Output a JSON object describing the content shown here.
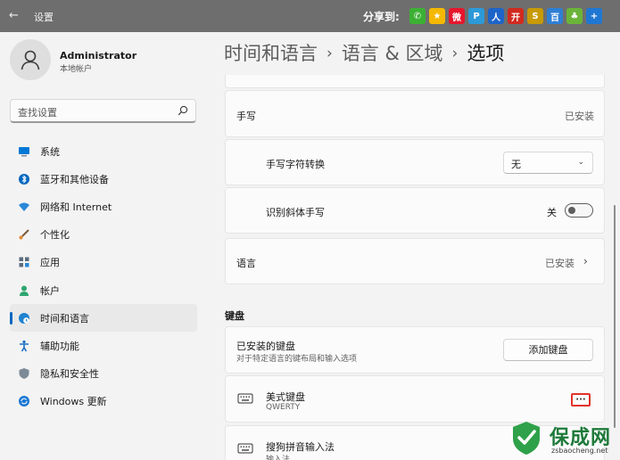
{
  "window": {
    "title": "设置",
    "back_glyph": "←"
  },
  "share": {
    "label": "分享到:",
    "icons": [
      {
        "name": "wechat-icon",
        "color": "#3cb034",
        "glyph": "✆"
      },
      {
        "name": "qzone-icon",
        "color": "#f5b800",
        "glyph": "★"
      },
      {
        "name": "weibo-icon",
        "color": "#e6162d",
        "glyph": "微"
      },
      {
        "name": "tencent-weibo-icon",
        "color": "#2c9ad8",
        "glyph": "P"
      },
      {
        "name": "renren-icon",
        "color": "#1e64c8",
        "glyph": "人"
      },
      {
        "name": "kaixin-icon",
        "color": "#d12a1f",
        "glyph": "开"
      },
      {
        "name": "douban-icon",
        "color": "#c79a06",
        "glyph": "S"
      },
      {
        "name": "baidu-icon",
        "color": "#2e7fd4",
        "glyph": "百"
      },
      {
        "name": "clover-icon",
        "color": "#6bb43a",
        "glyph": "♣"
      },
      {
        "name": "more-share-icon",
        "color": "#1f77d2",
        "glyph": "+"
      }
    ]
  },
  "user": {
    "name": "Administrator",
    "type": "本地帐户"
  },
  "search": {
    "placeholder": "查找设置"
  },
  "sidebar": {
    "items": [
      {
        "label": "系统",
        "icon": "monitor-icon",
        "color": "#0078d4"
      },
      {
        "label": "蓝牙和其他设备",
        "icon": "bluetooth-icon",
        "color": "#0067c0"
      },
      {
        "label": "网络和 Internet",
        "icon": "wifi-icon",
        "color": "#2a88d8"
      },
      {
        "label": "个性化",
        "icon": "brush-icon",
        "color": "#e18a2f"
      },
      {
        "label": "应用",
        "icon": "apps-icon",
        "color": "#5b6b7c"
      },
      {
        "label": "帐户",
        "icon": "person-icon",
        "color": "#2ea66f"
      },
      {
        "label": "时间和语言",
        "icon": "clock-globe-icon",
        "color": "#1f83d0",
        "active": true
      },
      {
        "label": "辅助功能",
        "icon": "accessibility-icon",
        "color": "#1b6fc4"
      },
      {
        "label": "隐私和安全性",
        "icon": "shield-icon",
        "color": "#7d8a97"
      },
      {
        "label": "Windows 更新",
        "icon": "sync-icon",
        "color": "#1c78d3"
      }
    ]
  },
  "breadcrumb": {
    "part1": "时间和语言",
    "part2": "语言 & 区域",
    "current": "选项",
    "sep": "›"
  },
  "handwriting": {
    "title": "手写",
    "status": "已安装",
    "convert_label": "手写字符转换",
    "convert_value": "无",
    "italic_label": "识别斜体手写",
    "italic_state": "关",
    "italic_on": false
  },
  "speech": {
    "title": "语言",
    "status": "已安装"
  },
  "keyboard": {
    "section_title": "键盘",
    "installed_title": "已安装的键盘",
    "installed_desc": "对于特定语言的键布局和输入选项",
    "add_button": "添加键盘",
    "items": [
      {
        "name": "美式键盘",
        "sub": "QWERTY"
      },
      {
        "name": "搜狗拼音输入法",
        "sub": "输入法"
      }
    ],
    "more_glyph": "···"
  },
  "watermark": {
    "main": "保成网",
    "sub": "zsbaocheng.net"
  }
}
